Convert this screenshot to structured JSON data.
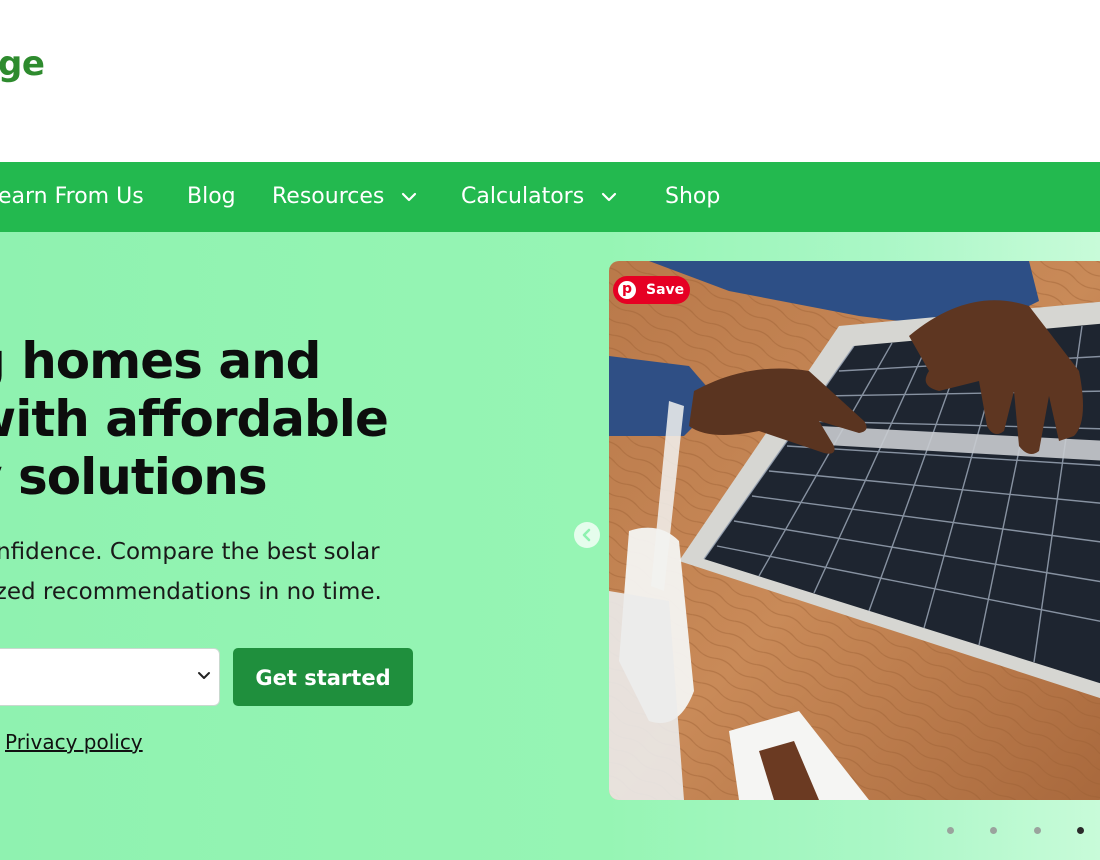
{
  "header": {
    "logo_fragment": "ge"
  },
  "nav": {
    "items": [
      {
        "label": "earn From Us",
        "has_dropdown": false
      },
      {
        "label": "Blog",
        "has_dropdown": false
      },
      {
        "label": "Resources",
        "has_dropdown": true
      },
      {
        "label": "Calculators",
        "has_dropdown": true
      },
      {
        "label": "Shop",
        "has_dropdown": false
      }
    ]
  },
  "hero": {
    "headline_lines": [
      "g homes and",
      "with affordable",
      "y solutions"
    ],
    "subtext_lines": [
      "onfidence. Compare the best solar",
      "lized recommendations in no time."
    ],
    "select_value": "",
    "cta_label": "Get started",
    "privacy_link": "Privacy policy",
    "save_badge": "Save",
    "carousel": {
      "slide_count": 4,
      "active_index": 3
    }
  },
  "colors": {
    "nav_bg": "#23b94f",
    "hero_gradient_start": "#8ff2b0",
    "cta_bg": "#1f8f3d",
    "logo_green": "#2e8b2e",
    "save_red": "#e60023"
  },
  "icons": [
    "chevron-down-icon",
    "pinterest-icon",
    "chevron-left-icon"
  ]
}
